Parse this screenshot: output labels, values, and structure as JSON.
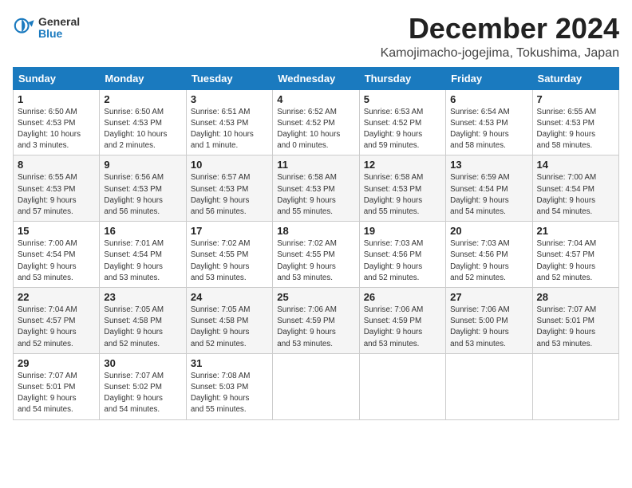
{
  "logo": {
    "general": "General",
    "blue": "Blue"
  },
  "header": {
    "month": "December 2024",
    "location": "Kamojimacho-jogejima, Tokushima, Japan"
  },
  "weekdays": [
    "Sunday",
    "Monday",
    "Tuesday",
    "Wednesday",
    "Thursday",
    "Friday",
    "Saturday"
  ],
  "weeks": [
    [
      {
        "day": "1",
        "info": "Sunrise: 6:50 AM\nSunset: 4:53 PM\nDaylight: 10 hours\nand 3 minutes."
      },
      {
        "day": "2",
        "info": "Sunrise: 6:50 AM\nSunset: 4:53 PM\nDaylight: 10 hours\nand 2 minutes."
      },
      {
        "day": "3",
        "info": "Sunrise: 6:51 AM\nSunset: 4:53 PM\nDaylight: 10 hours\nand 1 minute."
      },
      {
        "day": "4",
        "info": "Sunrise: 6:52 AM\nSunset: 4:52 PM\nDaylight: 10 hours\nand 0 minutes."
      },
      {
        "day": "5",
        "info": "Sunrise: 6:53 AM\nSunset: 4:52 PM\nDaylight: 9 hours\nand 59 minutes."
      },
      {
        "day": "6",
        "info": "Sunrise: 6:54 AM\nSunset: 4:53 PM\nDaylight: 9 hours\nand 58 minutes."
      },
      {
        "day": "7",
        "info": "Sunrise: 6:55 AM\nSunset: 4:53 PM\nDaylight: 9 hours\nand 58 minutes."
      }
    ],
    [
      {
        "day": "8",
        "info": "Sunrise: 6:55 AM\nSunset: 4:53 PM\nDaylight: 9 hours\nand 57 minutes."
      },
      {
        "day": "9",
        "info": "Sunrise: 6:56 AM\nSunset: 4:53 PM\nDaylight: 9 hours\nand 56 minutes."
      },
      {
        "day": "10",
        "info": "Sunrise: 6:57 AM\nSunset: 4:53 PM\nDaylight: 9 hours\nand 56 minutes."
      },
      {
        "day": "11",
        "info": "Sunrise: 6:58 AM\nSunset: 4:53 PM\nDaylight: 9 hours\nand 55 minutes."
      },
      {
        "day": "12",
        "info": "Sunrise: 6:58 AM\nSunset: 4:53 PM\nDaylight: 9 hours\nand 55 minutes."
      },
      {
        "day": "13",
        "info": "Sunrise: 6:59 AM\nSunset: 4:54 PM\nDaylight: 9 hours\nand 54 minutes."
      },
      {
        "day": "14",
        "info": "Sunrise: 7:00 AM\nSunset: 4:54 PM\nDaylight: 9 hours\nand 54 minutes."
      }
    ],
    [
      {
        "day": "15",
        "info": "Sunrise: 7:00 AM\nSunset: 4:54 PM\nDaylight: 9 hours\nand 53 minutes."
      },
      {
        "day": "16",
        "info": "Sunrise: 7:01 AM\nSunset: 4:54 PM\nDaylight: 9 hours\nand 53 minutes."
      },
      {
        "day": "17",
        "info": "Sunrise: 7:02 AM\nSunset: 4:55 PM\nDaylight: 9 hours\nand 53 minutes."
      },
      {
        "day": "18",
        "info": "Sunrise: 7:02 AM\nSunset: 4:55 PM\nDaylight: 9 hours\nand 53 minutes."
      },
      {
        "day": "19",
        "info": "Sunrise: 7:03 AM\nSunset: 4:56 PM\nDaylight: 9 hours\nand 52 minutes."
      },
      {
        "day": "20",
        "info": "Sunrise: 7:03 AM\nSunset: 4:56 PM\nDaylight: 9 hours\nand 52 minutes."
      },
      {
        "day": "21",
        "info": "Sunrise: 7:04 AM\nSunset: 4:57 PM\nDaylight: 9 hours\nand 52 minutes."
      }
    ],
    [
      {
        "day": "22",
        "info": "Sunrise: 7:04 AM\nSunset: 4:57 PM\nDaylight: 9 hours\nand 52 minutes."
      },
      {
        "day": "23",
        "info": "Sunrise: 7:05 AM\nSunset: 4:58 PM\nDaylight: 9 hours\nand 52 minutes."
      },
      {
        "day": "24",
        "info": "Sunrise: 7:05 AM\nSunset: 4:58 PM\nDaylight: 9 hours\nand 52 minutes."
      },
      {
        "day": "25",
        "info": "Sunrise: 7:06 AM\nSunset: 4:59 PM\nDaylight: 9 hours\nand 53 minutes."
      },
      {
        "day": "26",
        "info": "Sunrise: 7:06 AM\nSunset: 4:59 PM\nDaylight: 9 hours\nand 53 minutes."
      },
      {
        "day": "27",
        "info": "Sunrise: 7:06 AM\nSunset: 5:00 PM\nDaylight: 9 hours\nand 53 minutes."
      },
      {
        "day": "28",
        "info": "Sunrise: 7:07 AM\nSunset: 5:01 PM\nDaylight: 9 hours\nand 53 minutes."
      }
    ],
    [
      {
        "day": "29",
        "info": "Sunrise: 7:07 AM\nSunset: 5:01 PM\nDaylight: 9 hours\nand 54 minutes."
      },
      {
        "day": "30",
        "info": "Sunrise: 7:07 AM\nSunset: 5:02 PM\nDaylight: 9 hours\nand 54 minutes."
      },
      {
        "day": "31",
        "info": "Sunrise: 7:08 AM\nSunset: 5:03 PM\nDaylight: 9 hours\nand 55 minutes."
      },
      null,
      null,
      null,
      null
    ]
  ]
}
